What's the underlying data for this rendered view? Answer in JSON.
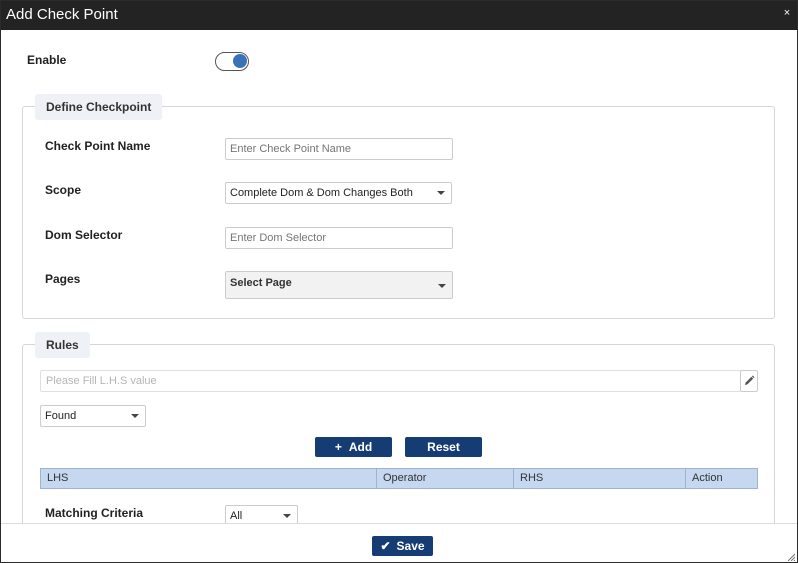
{
  "dialog": {
    "title": "Add Check Point",
    "close_label": "×"
  },
  "enable": {
    "label": "Enable",
    "state": true
  },
  "define_checkpoint": {
    "legend": "Define Checkpoint",
    "name_label": "Check Point Name",
    "name_placeholder": "Enter Check Point Name",
    "scope_label": "Scope",
    "scope_value": "Complete Dom & Dom Changes Both",
    "dom_selector_label": "Dom Selector",
    "dom_selector_placeholder": "Enter Dom Selector",
    "pages_label": "Pages",
    "pages_value": "Select Page"
  },
  "rules": {
    "legend": "Rules",
    "lhs_placeholder": "Please Fill L.H.S value",
    "operator_value": "Found",
    "add_label": "Add",
    "reset_label": "Reset",
    "columns": [
      "LHS",
      "Operator",
      "RHS",
      "Action"
    ],
    "matching_criteria_label": "Matching Criteria",
    "matching_criteria_value": "All"
  },
  "footer": {
    "save_label": "Save"
  },
  "colors": {
    "titlebar": "#232323",
    "primary_button": "#163d73",
    "table_header": "#c5d8ef",
    "toggle_on": "#3a72b8"
  }
}
